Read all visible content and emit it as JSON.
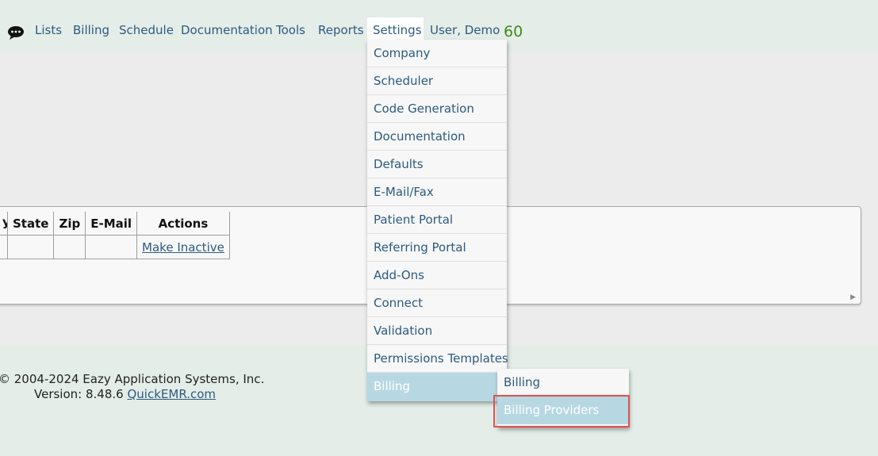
{
  "nav": {
    "chat_icon": "chat-bubble-icon",
    "items": [
      "Lists",
      "Billing",
      "Schedule",
      "Documentation",
      "Tools",
      "Reports"
    ],
    "settings": "Settings",
    "user": "User, Demo",
    "count": "60"
  },
  "table": {
    "headers": [
      "y",
      "State",
      "Zip",
      "E-Mail",
      "Actions"
    ],
    "row": {
      "action": "Make Inactive"
    }
  },
  "footer": {
    "copyright": "© 2004-2024 Eazy Application Systems, Inc.",
    "version_prefix": "Version: 8.48.6",
    "link": "QuickEMR.com"
  },
  "settings_menu": {
    "items": [
      "Company",
      "Scheduler",
      "Code Generation",
      "Documentation",
      "Defaults",
      "E-Mail/Fax",
      "Patient Portal",
      "Referring Portal",
      "Add-Ons",
      "Connect",
      "Validation",
      "Permissions Templates",
      "Billing"
    ],
    "active": "Billing"
  },
  "billing_submenu": {
    "items": [
      "Billing",
      "Billing Providers"
    ],
    "highlighted": "Billing Providers"
  },
  "colors": {
    "link": "#2d5a80",
    "active_bg": "#b7d8e2",
    "count_green": "#3f8a1e",
    "annotation_red": "#e05050"
  }
}
